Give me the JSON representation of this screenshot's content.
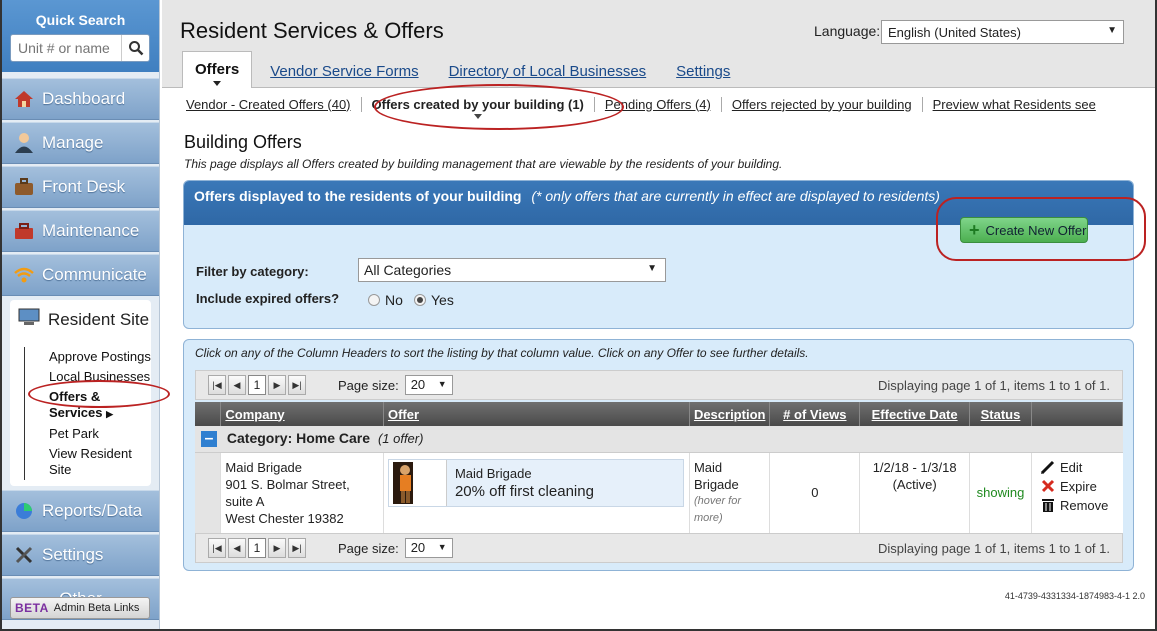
{
  "sidebar": {
    "quick_search": {
      "title": "Quick Search",
      "placeholder": "Unit # or name"
    },
    "nav": [
      {
        "label": "Dashboard"
      },
      {
        "label": "Manage"
      },
      {
        "label": "Front Desk"
      },
      {
        "label": "Maintenance"
      },
      {
        "label": "Communicate"
      }
    ],
    "resident_site": {
      "title": "Resident Site",
      "links": [
        "Approve Postings",
        "Local Businesses",
        "Offers & Services",
        "Pet Park",
        "View Resident Site"
      ],
      "active_index": 2
    },
    "nav_bottom": [
      {
        "label": "Reports/Data"
      },
      {
        "label": "Settings"
      },
      {
        "label": "Other"
      }
    ],
    "beta": {
      "badge": "BETA",
      "label": "Admin Beta Links"
    }
  },
  "header": {
    "title": "Resident Services & Offers",
    "language_label": "Language:",
    "language_value": "English (United States)",
    "tabs": [
      "Offers",
      "Vendor Service Forms",
      "Directory of Local Businesses",
      "Settings"
    ],
    "active_tab": 0
  },
  "subtabs": [
    "Vendor - Created Offers (40)",
    "Offers created by your building (1)",
    "Pending Offers (4)",
    "Offers rejected by your building",
    "Preview what Residents see"
  ],
  "section": {
    "title": "Building Offers",
    "description": "This page displays all Offers created by building management that are viewable by the residents of your building."
  },
  "offer_panel": {
    "header": "Offers displayed to the residents of your building",
    "header_note": "(* only offers that are currently in effect are displayed to residents)",
    "create_button": "Create New Offer",
    "filter_label": "Filter by category:",
    "filter_value": "All Categories",
    "expired_label": "Include expired offers?",
    "radio_no": "No",
    "radio_yes": "Yes",
    "radio_selected": "Yes"
  },
  "list": {
    "hint": "Click on any of the Column Headers to sort the listing by that column value. Click on any Offer to see further details.",
    "page": "1",
    "page_size_label": "Page size:",
    "page_size": "20",
    "info": "Displaying page 1 of 1, items 1 to 1 of 1.",
    "columns": [
      "Company",
      "Offer",
      "Description",
      "# of Views",
      "Effective Date",
      "Status"
    ],
    "category": {
      "label": "Category: Home Care",
      "count": "(1 offer)"
    },
    "rows": [
      {
        "company_lines": [
          "Maid Brigade",
          "901 S. Bolmar Street,",
          "suite A",
          "West Chester 19382"
        ],
        "offer_title": "Maid Brigade",
        "offer_subtitle": "20% off first cleaning",
        "description": "Maid Brigade",
        "description_hint": "(hover for more)",
        "views": "0",
        "effective_date": "1/2/18 - 1/3/18",
        "effective_state": "(Active)",
        "status": "showing",
        "actions": [
          "Edit",
          "Expire",
          "Remove"
        ]
      }
    ]
  },
  "footer_id": "41-4739-4331334-1874983-4-1 2.0",
  "colors": {
    "accent_blue": "#2f68a6",
    "create_green": "#4caf50",
    "status_green": "#1f8a1f",
    "highlight_red": "#b22222"
  }
}
